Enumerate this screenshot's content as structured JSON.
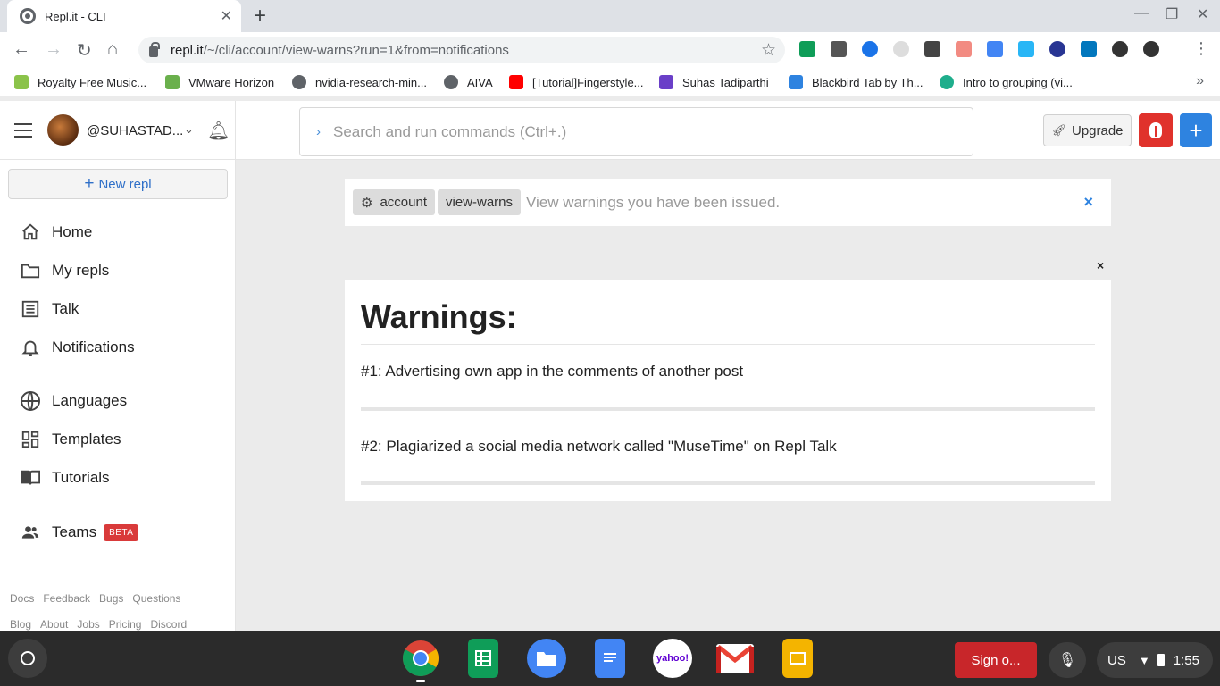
{
  "browser": {
    "tab_title": "Repl.it - CLI",
    "tab_close": "✕",
    "new_tab": "+",
    "url_host": "repl.it",
    "url_path": "/~/cli/account/view-warns?run=1&from=notifications",
    "window_controls": [
      "—",
      "❐",
      "✕"
    ],
    "bookmarks": [
      {
        "label": "Royalty Free Music...",
        "color": "#8bc34a"
      },
      {
        "label": "VMware Horizon",
        "color": "#6ab04c"
      },
      {
        "label": "nvidia-research-min...",
        "color": "#5f6368"
      },
      {
        "label": "AIVA",
        "color": "#5f6368"
      },
      {
        "label": "[Tutorial]Fingerstyle...",
        "color": "#ff0000"
      },
      {
        "label": "Suhas Tadiparthi",
        "color": "#6a3fc8"
      },
      {
        "label": "Blackbird Tab by Th...",
        "color": "#2e83e0"
      },
      {
        "label": "Intro to grouping (vi...",
        "color": "#1fae8c"
      }
    ],
    "bookmarks_more": "»"
  },
  "header": {
    "username": "@SUHASTAD...",
    "search_placeholder": "Search and run commands (Ctrl+.)",
    "upgrade_label": "Upgrade",
    "plus_label": "+"
  },
  "sidebar": {
    "new_repl_label": "New repl",
    "items": [
      {
        "label": "Home",
        "icon": "home-icon"
      },
      {
        "label": "My repls",
        "icon": "folder-icon"
      },
      {
        "label": "Talk",
        "icon": "list-icon"
      },
      {
        "label": "Notifications",
        "icon": "bell-icon"
      },
      {
        "label": "Languages",
        "icon": "globe-icon"
      },
      {
        "label": "Templates",
        "icon": "templates-icon"
      },
      {
        "label": "Tutorials",
        "icon": "book-icon"
      },
      {
        "label": "Teams",
        "icon": "people-icon",
        "badge": "BETA"
      }
    ],
    "footer_row1": [
      "Docs",
      "Feedback",
      "Bugs",
      "Questions"
    ],
    "footer_row2": [
      "Blog",
      "About",
      "Jobs",
      "Pricing",
      "Discord"
    ]
  },
  "cli": {
    "chip1": "account",
    "chip2": "view-warns",
    "description": "View warnings you have been issued.",
    "close": "×"
  },
  "warnings": {
    "close": "×",
    "title": "Warnings:",
    "items": [
      "#1: Advertising own app in the comments of another post",
      "#2: Plagiarized a social media network called \"MuseTime\" on Repl Talk"
    ]
  },
  "shelf": {
    "apps": [
      {
        "name": "chrome",
        "color": "#ffffff"
      },
      {
        "name": "sheets",
        "color": "#0f9d58"
      },
      {
        "name": "files",
        "color": "#4285f4"
      },
      {
        "name": "docs",
        "color": "#4285f4"
      },
      {
        "name": "yahoo",
        "label": "yahoo!",
        "color": "#ffffff"
      },
      {
        "name": "gmail",
        "color": "#ffffff"
      },
      {
        "name": "slides",
        "color": "#f4b400"
      }
    ],
    "signout_label": "Sign o...",
    "locale": "US",
    "time": "1:55"
  }
}
